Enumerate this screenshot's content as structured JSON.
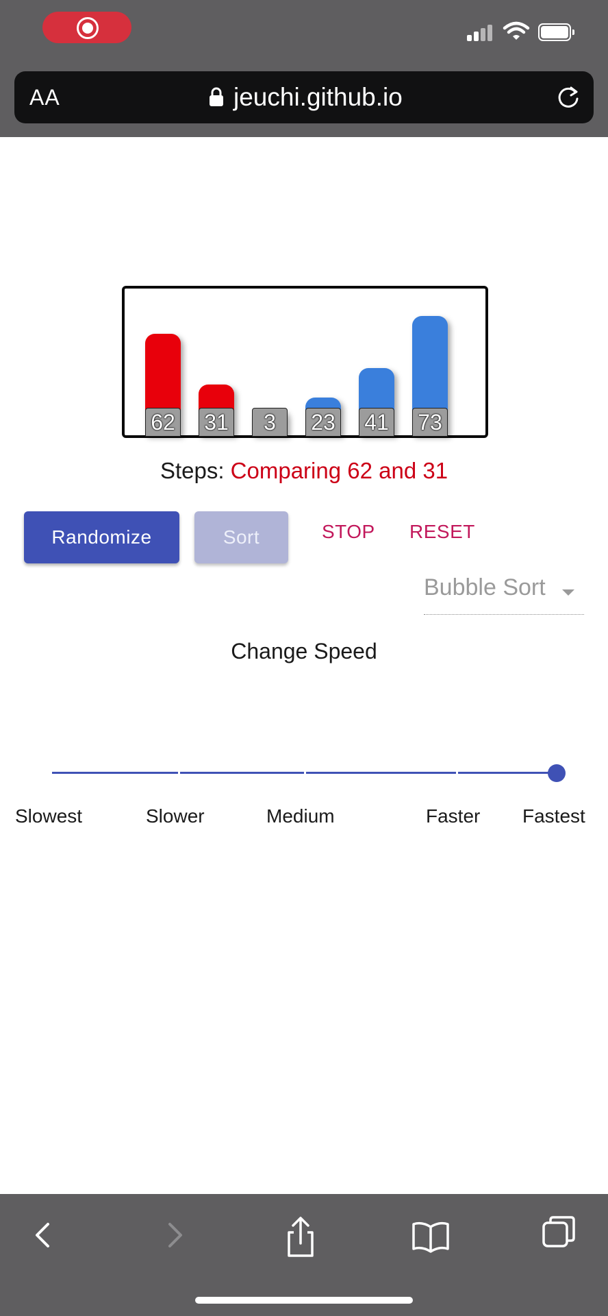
{
  "browser": {
    "aa_label": "AA",
    "domain": "jeuchi.github.io",
    "colors": {
      "chrome": "#5f5e60",
      "url_bar": "#111112",
      "record": "#d6303d"
    }
  },
  "chart_data": {
    "type": "bar",
    "categories": [
      "62",
      "31",
      "3",
      "23",
      "41",
      "73"
    ],
    "values": [
      62,
      31,
      3,
      23,
      41,
      73
    ],
    "bar_colors": [
      "#e8000b",
      "#e8000b",
      "#3a7fdc",
      "#3a7fdc",
      "#3a7fdc",
      "#3a7fdc"
    ],
    "highlighted_compare": [
      62,
      31
    ]
  },
  "steps": {
    "label": "Steps:",
    "message": "Comparing 62 and 31"
  },
  "controls": {
    "randomize_label": "Randomize",
    "sort_label": "Sort",
    "stop_label": "STOP",
    "reset_label": "RESET",
    "algorithm_select": "Bubble Sort"
  },
  "speed": {
    "title": "Change Speed",
    "levels": [
      "Slowest",
      "Slower",
      "Medium",
      "Faster",
      "Fastest"
    ],
    "selected": "Fastest"
  },
  "toolbar_icons": [
    "back-icon",
    "forward-icon",
    "share-icon",
    "bookmarks-icon",
    "tabs-icon"
  ]
}
